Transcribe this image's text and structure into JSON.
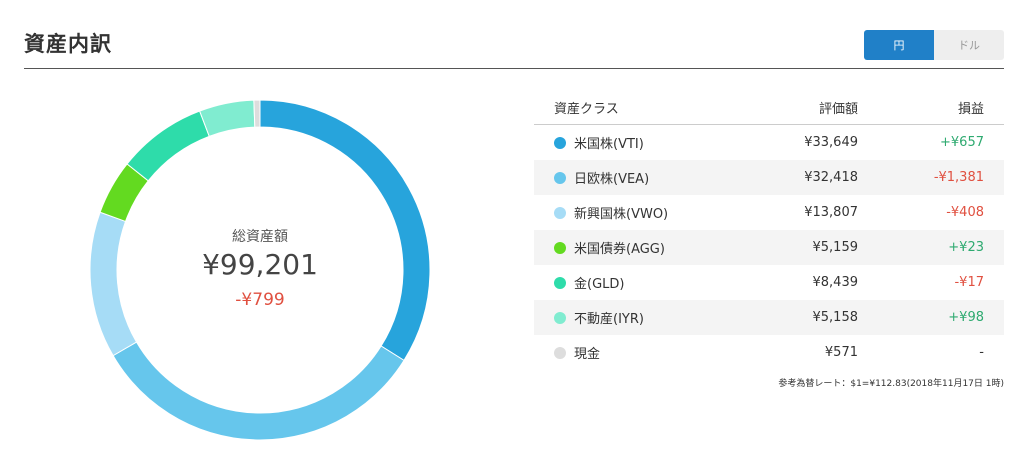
{
  "header": {
    "title": "資産内訳",
    "currency_yen": "円",
    "currency_dollar": "ドル"
  },
  "summary": {
    "label": "総資産額",
    "total": "¥99,201",
    "gain": "-¥799"
  },
  "table": {
    "col_class": "資産クラス",
    "col_value": "評価額",
    "col_gain": "損益",
    "rows": [
      {
        "name": "米国株(VTI)",
        "value": "¥33,649",
        "gain": "+¥657",
        "color": "#27a4dc",
        "sign": "pos"
      },
      {
        "name": "日欧株(VEA)",
        "value": "¥32,418",
        "gain": "-¥1,381",
        "color": "#66c6ec",
        "sign": "neg"
      },
      {
        "name": "新興国株(VWO)",
        "value": "¥13,807",
        "gain": "-¥408",
        "color": "#a6dcf6",
        "sign": "neg"
      },
      {
        "name": "米国債券(AGG)",
        "value": "¥5,159",
        "gain": "+¥23",
        "color": "#63da20",
        "sign": "pos"
      },
      {
        "name": "金(GLD)",
        "value": "¥8,439",
        "gain": "-¥17",
        "color": "#2edcaa",
        "sign": "neg"
      },
      {
        "name": "不動産(IYR)",
        "value": "¥5,158",
        "gain": "+¥98",
        "color": "#80ecd0",
        "sign": "pos"
      },
      {
        "name": "現金",
        "value": "¥571",
        "gain": "-",
        "color": "#dddddd",
        "sign": "none"
      }
    ]
  },
  "footnote": "参考為替レート：$1=¥112.83(2018年11月17日 1時)",
  "chart_data": {
    "type": "pie",
    "categories": [
      "米国株(VTI)",
      "日欧株(VEA)",
      "新興国株(VWO)",
      "米国債券(AGG)",
      "金(GLD)",
      "不動産(IYR)",
      "現金"
    ],
    "values": [
      33649,
      32418,
      13807,
      5159,
      8439,
      5158,
      571
    ],
    "colors": [
      "#27a4dc",
      "#66c6ec",
      "#a6dcf6",
      "#63da20",
      "#2edcaa",
      "#80ecd0",
      "#dddddd"
    ]
  }
}
